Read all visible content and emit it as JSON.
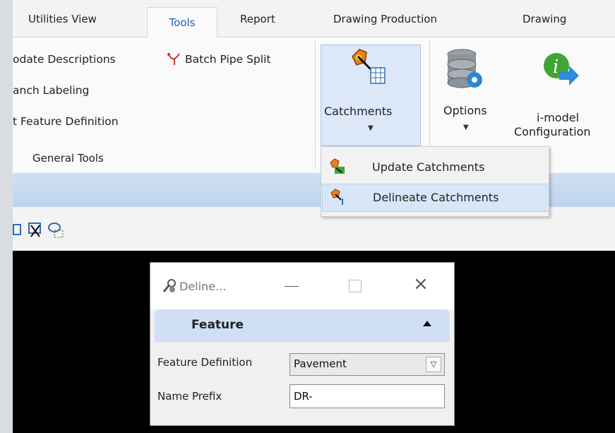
{
  "tabs": [
    {
      "label": "Utilities View"
    },
    {
      "label": "Tools"
    },
    {
      "label": "Report"
    },
    {
      "label": "Drawing Production"
    },
    {
      "label": "Drawing"
    }
  ],
  "ribbon": {
    "general_tools": {
      "update_descriptions": "odate Descriptions",
      "batch_pipe_split": "Batch Pipe Split",
      "branch_labeling": "anch Labeling",
      "set_feature_definition": "t Feature Definition",
      "group_label": "General Tools"
    },
    "catchments_label": "Catchments",
    "options_label": "Options",
    "imodel_line1": "i-model",
    "imodel_line2": "Configuration"
  },
  "catchments_menu": {
    "items": [
      {
        "label": "Update Catchments"
      },
      {
        "label": "Delineate Catchments"
      }
    ]
  },
  "dialog": {
    "title": "Deline...",
    "section": "Feature",
    "feature_definition_label": "Feature Definition",
    "feature_definition_value": "Pavement",
    "name_prefix_label": "Name Prefix",
    "name_prefix_value": "DR-"
  },
  "icons": [
    "pipe-split-icon",
    "catchments-icon",
    "options-icon",
    "imodel-icon",
    "update-catchments-icon",
    "delineate-catchments-icon",
    "select-icon",
    "scissors-icon",
    "lasso-icon",
    "dialog-tool-icon",
    "minimize-icon",
    "maximize-icon",
    "close-icon",
    "collapse-icon",
    "dropdown-arrow-icon"
  ],
  "colors": {
    "accent": "#1b63b3",
    "panel_highlight": "#dce8f8",
    "menu_highlight": "#d7e7f7"
  }
}
